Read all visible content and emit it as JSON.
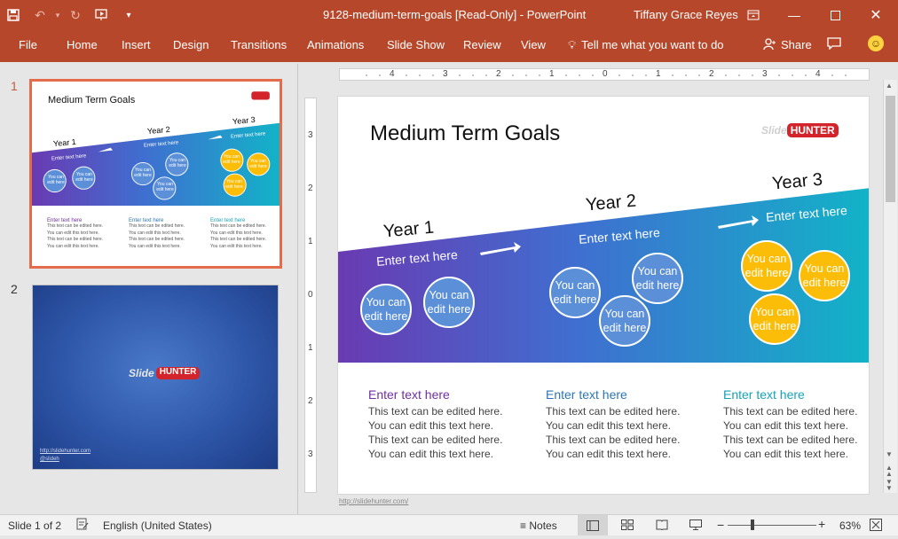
{
  "titlebar": {
    "doc_title": "9128-medium-term-goals [Read-Only]  -  PowerPoint",
    "user": "Tiffany Grace Reyes"
  },
  "ribbon": {
    "tabs": [
      "File",
      "Home",
      "Insert",
      "Design",
      "Transitions",
      "Animations",
      "Slide Show",
      "Review",
      "View"
    ],
    "tellme": "Tell me what you want to do",
    "share": "Share"
  },
  "thumbnails": {
    "numbers": [
      "1",
      "2"
    ],
    "t1": {
      "title": "Medium Term Goals",
      "years": [
        "Year 1",
        "Year 2",
        "Year 3"
      ],
      "enter": "Enter text here",
      "bubble": "You can edit here",
      "col_title": "Enter text here",
      "col_lines": [
        "This text can be edited here.",
        "You can edit this text here.",
        "This text can be edited here.",
        "You can edit this text here."
      ]
    },
    "t2": {
      "logo_a": "Slide",
      "logo_b": "HUNTER",
      "link1": "http://slidehunter.com",
      "link2": "@slideh"
    }
  },
  "ruler": {
    "h": [
      "4",
      "3",
      "2",
      "1",
      "0",
      "1",
      "2",
      "3",
      "4"
    ],
    "v": [
      "3",
      "2",
      "1",
      "0",
      "1",
      "2",
      "3"
    ]
  },
  "slide": {
    "title": "Medium Term Goals",
    "logo_a": "Slide",
    "logo_b": "HUNTER",
    "years": [
      "Year 1",
      "Year 2",
      "Year 3"
    ],
    "enter_text": [
      "Enter text here",
      "Enter text here",
      "Enter text here"
    ],
    "bubble_lines": [
      "You can",
      "edit here"
    ],
    "columns": [
      {
        "title": "Enter text here",
        "color": "#7030a0",
        "body": "This text can be edited here.\nYou can edit this text here.\nThis text can be edited here.\nYou can edit this text here."
      },
      {
        "title": "Enter text here",
        "color": "#2e75b6",
        "body": "This text can be edited here.\nYou can edit this text here.\nThis text can be edited here.\nYou can edit this text here."
      },
      {
        "title": "Enter text here",
        "color": "#17a2b8",
        "body": "This text can be edited here.\nYou can edit this text here.\nThis text can be edited here.\nYou can edit this text here."
      }
    ],
    "footer": "http://slidehunter.com/"
  },
  "status": {
    "slide_of": "Slide 1 of 2",
    "language": "English (United States)",
    "notes": "Notes",
    "zoom": "63%",
    "zoom_value": 63
  },
  "colors": {
    "accent": "#b7472a",
    "band_start": "#6a3ab2",
    "band_mid": "#3f6fd0",
    "band_end": "#12b3c8",
    "bubble_blue": "#5b8fd8",
    "bubble_yellow": "#fbbd08"
  }
}
